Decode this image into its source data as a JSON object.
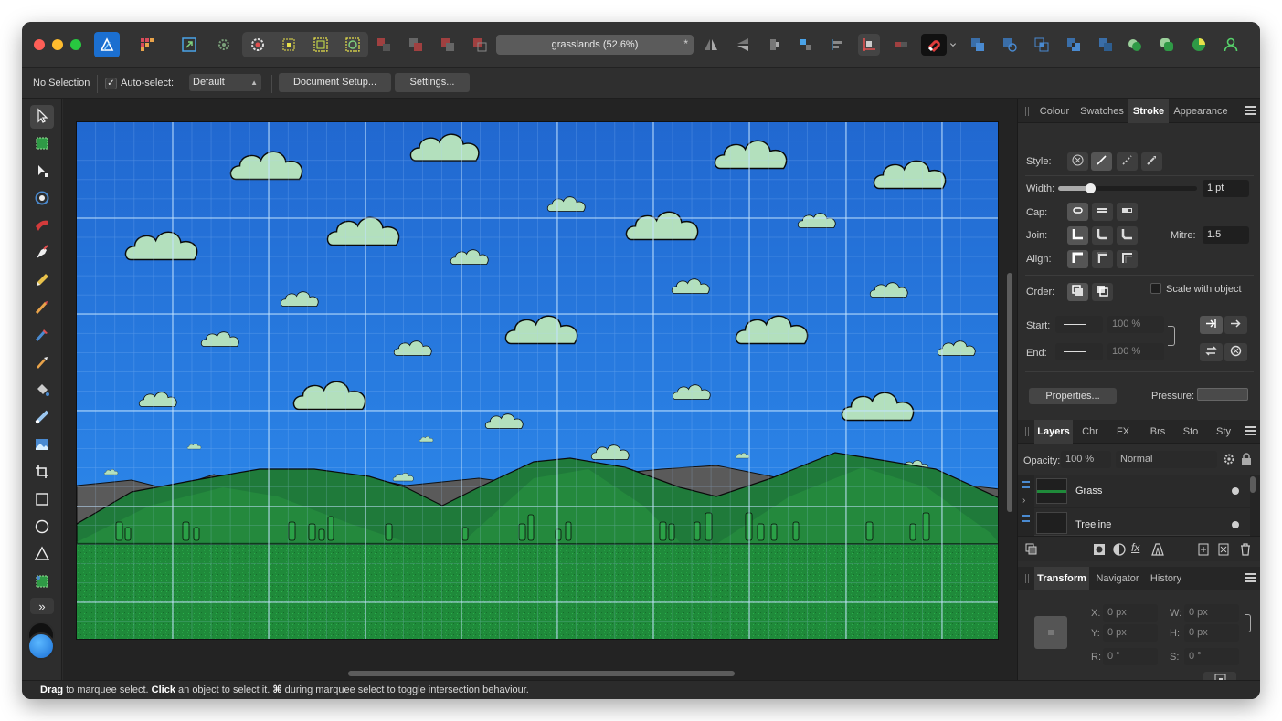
{
  "document": {
    "title": "grasslands (52.6%)",
    "modified_mark": "*"
  },
  "context_bar": {
    "selection_status": "No Selection",
    "auto_select_label": "Auto-select:",
    "auto_select_checked": "✓",
    "auto_select_value": "Default",
    "document_setup_label": "Document Setup...",
    "settings_label": "Settings..."
  },
  "stroke_panel": {
    "tabs": [
      "Colour",
      "Swatches",
      "Stroke",
      "Appearance"
    ],
    "active_tab": "Stroke",
    "style_label": "Style:",
    "width_label": "Width:",
    "width_value": "1 pt",
    "width_slider_fraction": 0.23,
    "cap_label": "Cap:",
    "join_label": "Join:",
    "mitre_label": "Mitre:",
    "mitre_value": "1.5",
    "align_label": "Align:",
    "order_label": "Order:",
    "scale_with_object_label": "Scale with object",
    "start_label": "Start:",
    "start_scale": "100 %",
    "end_label": "End:",
    "end_scale": "100 %",
    "properties_label": "Properties...",
    "pressure_label": "Pressure:"
  },
  "layers_panel": {
    "tabs": [
      "Layers",
      "Chr",
      "FX",
      "Brs",
      "Sto",
      "Sty"
    ],
    "active_tab": "Layers",
    "opacity_label": "Opacity:",
    "opacity_value": "100 %",
    "blend_mode": "Normal",
    "layers": [
      {
        "name": "Grass"
      },
      {
        "name": "Treeline"
      }
    ]
  },
  "transform_panel": {
    "tabs": [
      "Transform",
      "Navigator",
      "History"
    ],
    "active_tab": "Transform",
    "x_label": "X:",
    "x_value": "0 px",
    "y_label": "Y:",
    "y_value": "0 px",
    "w_label": "W:",
    "w_value": "0 px",
    "h_label": "H:",
    "h_value": "0 px",
    "r_label": "R:",
    "r_value": "0 °",
    "s_label": "S:",
    "s_value": "0 °"
  },
  "status_bar": {
    "drag_word": "Drag",
    "drag_text": " to marquee select. ",
    "click_word": "Click",
    "click_text": " an object to select it. ",
    "cmd_word": "⌘",
    "cmd_text": " during marquee select to toggle intersection behaviour."
  },
  "colors": {
    "sky": "#2a76d6",
    "cloud": "#b3e0bd",
    "hill": "#1f7a3a",
    "grass": "#1e8a3a",
    "accent": "#1f8ee6"
  }
}
